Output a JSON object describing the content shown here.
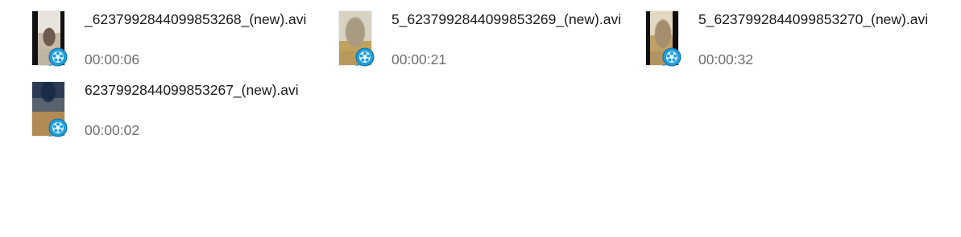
{
  "files": [
    {
      "name": "_6237992844099853268_(new).avi",
      "duration": "00:00:06",
      "thumbnail_icon": "video-thumbnail-icon",
      "badge_icon": "video-file-badge-icon"
    },
    {
      "name": "5_6237992844099853269_(new).avi",
      "duration": "00:00:21",
      "thumbnail_icon": "video-thumbnail-icon",
      "badge_icon": "video-file-badge-icon"
    },
    {
      "name": "5_6237992844099853270_(new).avi",
      "duration": "00:00:32",
      "thumbnail_icon": "video-thumbnail-icon",
      "badge_icon": "video-file-badge-icon"
    },
    {
      "name": "6237992844099853267_(new).avi",
      "duration": "00:00:02",
      "thumbnail_icon": "video-thumbnail-icon",
      "badge_icon": "video-file-badge-icon"
    }
  ],
  "colors": {
    "badge": "#1e9fdc",
    "name_text": "#1a1a1a",
    "duration_text": "#6e6e6e"
  }
}
